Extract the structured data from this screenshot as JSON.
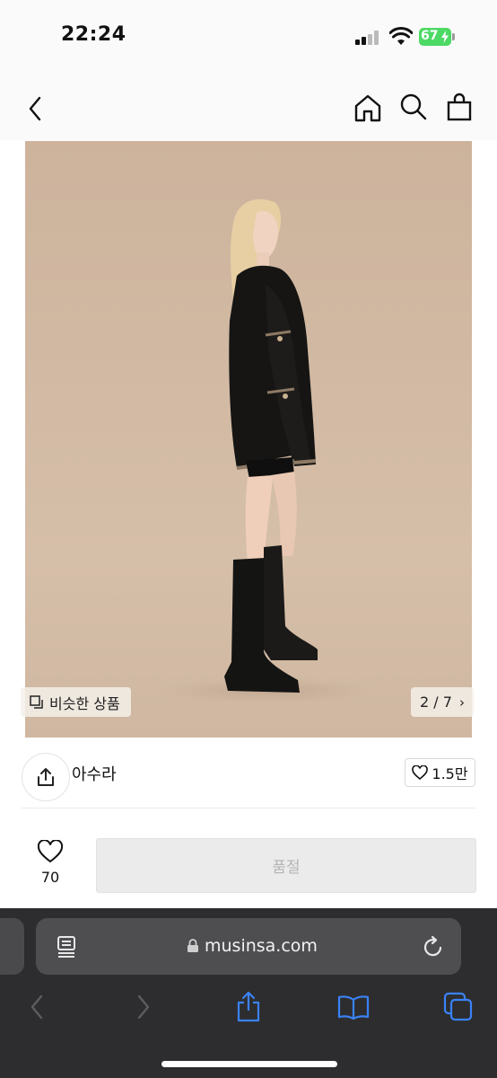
{
  "status_bar": {
    "time": "22:24",
    "battery": "67"
  },
  "product": {
    "similar_label": "비슷한 상품",
    "image_counter": "2 / 7",
    "brand": "아수라",
    "like_count": "1.5만",
    "favorite_count": "70",
    "soldout_label": "품절"
  },
  "browser": {
    "url": "musinsa.com"
  },
  "colors": {
    "accent_blue": "#3a82f7",
    "battery_green": "#4cd964",
    "photo_bg": "#d2baa4"
  }
}
